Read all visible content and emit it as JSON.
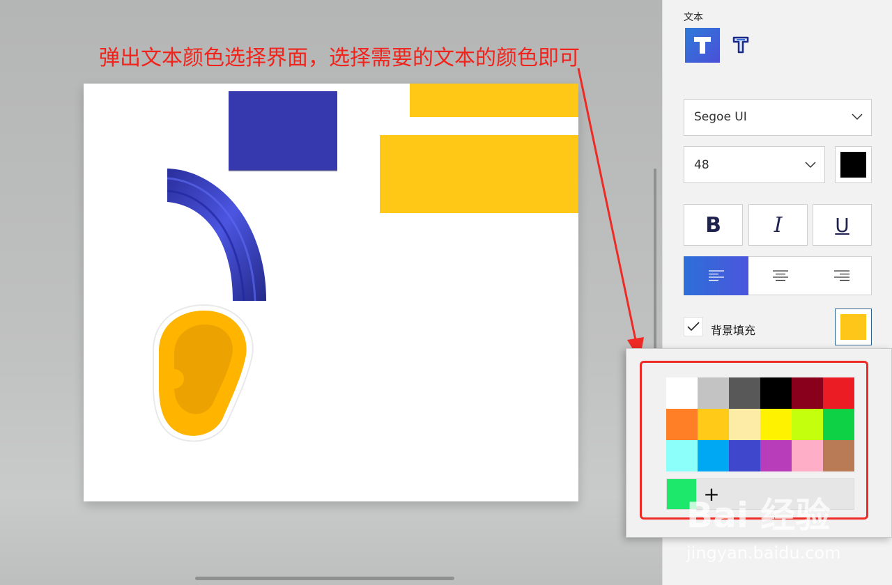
{
  "annotation": {
    "text": "弹出文本颜色选择界面，选择需要的文本的颜色即可"
  },
  "panel": {
    "section_title": "文本",
    "font": {
      "selected": "Segoe UI"
    },
    "size": {
      "selected": "48"
    },
    "text_color": "#000000",
    "bold_label": "B",
    "italic_label": "I",
    "underline_label": "U",
    "align": {
      "selected": "left"
    },
    "background_fill": {
      "label": "背景填充",
      "checked": true,
      "color": "#ffc61a"
    }
  },
  "color_picker": {
    "swatches": [
      "#ffffff",
      "#c3c3c3",
      "#585858",
      "#000000",
      "#88001b",
      "#ec1c24",
      "#ff7f27",
      "#ffca18",
      "#fdeca6",
      "#fff200",
      "#c4ff0e",
      "#0ed145",
      "#8cfffb",
      "#00a8f3",
      "#3f48cc",
      "#b83dba",
      "#ffaec8",
      "#b97a56"
    ],
    "custom_color": "#1de86b",
    "add_label": "+"
  },
  "watermark": {
    "brand": "Bai  经验",
    "url": "jingyan.baidu.com"
  },
  "colors": {
    "accent": "#2b5fd9",
    "highlight_red": "#ee2a24"
  }
}
